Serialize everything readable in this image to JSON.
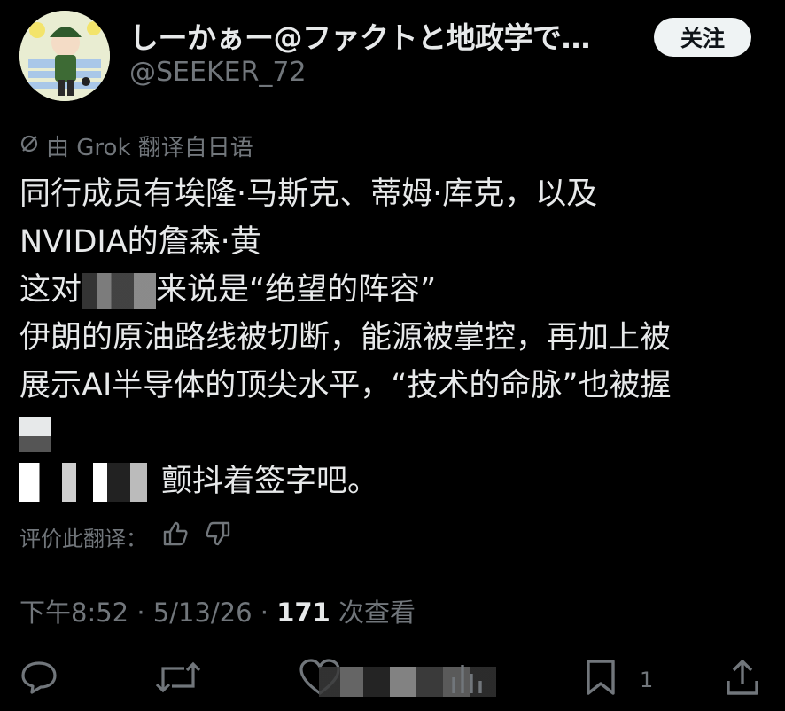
{
  "header": {
    "display_name": "しーかぁー@ファクトと地政学で…",
    "handle": "@SEEKER_72",
    "follow_label": "关注"
  },
  "translation_note": "由 Grok 翻译自日语",
  "tweet_lines": {
    "l1": "同行成员有埃隆·马斯克、蒂姆·库克，以及",
    "l2": "NVIDIA的詹森·黄",
    "l3_a": "这对",
    "l3_b": "来说是“绝望的阵容”",
    "l4": "伊朗的原油路线被切断，能源被掌控，再加上被",
    "l5": "展示AI半导体的顶尖水平，“技术的命脉”也被握",
    "l7_b": "颤抖着签字吧。"
  },
  "rate": {
    "label": "评价此翻译："
  },
  "meta": {
    "time": "下午8:52 · 5/13/26 · ",
    "views": "171",
    "views_suffix": " 次查看"
  },
  "actions": {
    "bookmark_count": "1"
  },
  "colors": {
    "background": "#000000",
    "text": "#e7e9ea",
    "secondary": "#71767b",
    "follow_bg": "#eff3f4"
  }
}
